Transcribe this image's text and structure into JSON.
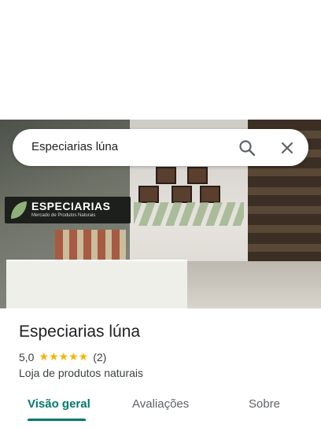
{
  "search": {
    "query": "Especiarias lúna"
  },
  "photo": {
    "sign_title": "ESPECIARIAS",
    "sign_subtitle": "Mercado de Produtos Naturais"
  },
  "place": {
    "name": "Especiarias lúna",
    "rating": "5,0",
    "stars": "★★★★★",
    "review_count": "(2)",
    "category": "Loja de produtos naturais"
  },
  "tabs": [
    {
      "label": "Visão geral"
    },
    {
      "label": "Avaliações"
    },
    {
      "label": "Sobre"
    }
  ],
  "colors": {
    "accent": "#00796b",
    "star": "#f5b400"
  },
  "icons": {
    "search": "search-icon",
    "close": "close-icon"
  }
}
